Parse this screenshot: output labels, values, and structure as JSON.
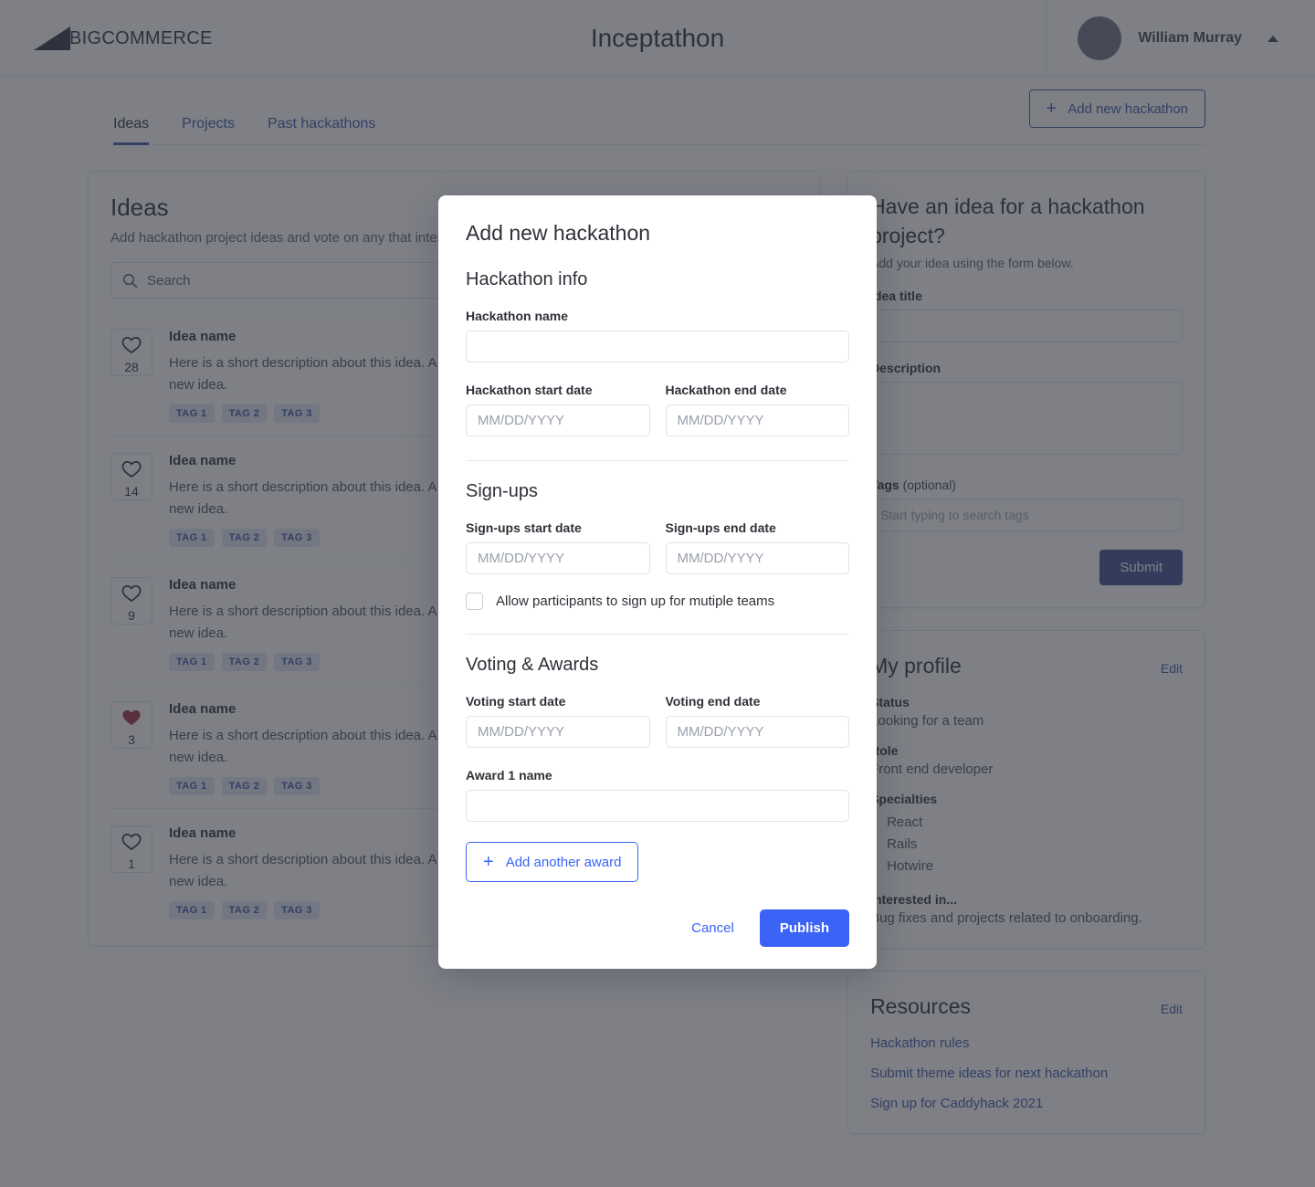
{
  "header": {
    "logo_text_bold": "BIG",
    "logo_text_rest": "COMMERCE",
    "app_title": "Inceptathon",
    "user_name": "William Murray",
    "avatar_icon": "avatar-placeholder",
    "caret_icon": "chevron-up-icon"
  },
  "nav": {
    "tabs": [
      {
        "label": "Ideas",
        "active": true
      },
      {
        "label": "Projects",
        "active": false
      },
      {
        "label": "Past hackathons",
        "active": false
      }
    ],
    "add_hackathon_label": "Add new hackathon",
    "add_icon": "plus-icon"
  },
  "ideas": {
    "title": "Ideas",
    "subtitle": "Add hackathon project ideas and vote on any that interest you.",
    "search_placeholder": "Search",
    "search_icon": "search-icon",
    "items": [
      {
        "name": "Idea name",
        "votes": "28",
        "liked": false,
        "description": "Here is a short description about this idea. A max word count in the form to add a new idea.",
        "tags": [
          "TAG 1",
          "TAG 2",
          "TAG 3"
        ]
      },
      {
        "name": "Idea name",
        "votes": "14",
        "liked": false,
        "description": "Here is a short description about this idea. A max word count in the form to add a new idea.",
        "tags": [
          "TAG 1",
          "TAG 2",
          "TAG 3"
        ]
      },
      {
        "name": "Idea name",
        "votes": "9",
        "liked": false,
        "description": "Here is a short description about this idea. A max word count in the form to add a new idea.",
        "tags": [
          "TAG 1",
          "TAG 2",
          "TAG 3"
        ]
      },
      {
        "name": "Idea name",
        "votes": "3",
        "liked": true,
        "description": "Here is a short description about this idea. A max word count in the form to add a new idea.",
        "tags": [
          "TAG 1",
          "TAG 2",
          "TAG 3"
        ]
      },
      {
        "name": "Idea name",
        "votes": "1",
        "liked": false,
        "description": "Here is a short description about this idea. A max word count in the form to add a new idea.",
        "tags": [
          "TAG 1",
          "TAG 2",
          "TAG 3"
        ]
      }
    ]
  },
  "idea_form": {
    "title": "Have an idea for a hackathon project?",
    "subtitle": "Add your idea using the form below.",
    "title_label": "Idea title",
    "title_value": "",
    "description_label": "Description",
    "description_value": "",
    "tags_label": "Tags",
    "tags_label_optional": " (optional)",
    "tags_placeholder": "Start typing to search tags",
    "submit_label": "Submit"
  },
  "profile": {
    "title": "My profile",
    "edit_label": "Edit",
    "status_label": "Status",
    "status_value": "Looking for a team",
    "role_label": "Role",
    "role_value": "Front end developer",
    "specialties_label": "Specialties",
    "specialties": [
      "React",
      "Rails",
      "Hotwire"
    ],
    "interested_label": "Interested in...",
    "interested_value": "Bug fixes and projects related to onboarding."
  },
  "resources": {
    "title": "Resources",
    "edit_label": "Edit",
    "links": [
      "Hackathon rules",
      "Submit theme ideas for next hackathon",
      "Sign up for Caddyhack 2021"
    ]
  },
  "modal": {
    "title": "Add new hackathon",
    "section_info": "Hackathon info",
    "name_label": "Hackathon name",
    "name_value": "",
    "start_label": "Hackathon start date",
    "end_label": "Hackathon end date",
    "date_placeholder": "MM/DD/YYYY",
    "section_signups": "Sign-ups",
    "signup_start_label": "Sign-ups start date",
    "signup_end_label": "Sign-ups end date",
    "multi_team_label": "Allow participants to sign up for mutiple teams",
    "multi_team_checked": false,
    "section_voting": "Voting & Awards",
    "voting_start_label": "Voting start date",
    "voting_end_label": "Voting end date",
    "award_label": "Award 1 name",
    "award_value": "",
    "add_award_label": "Add another award",
    "add_award_icon": "plus-icon",
    "cancel_label": "Cancel",
    "publish_label": "Publish"
  },
  "colors": {
    "brand_navy": "#3c55a5",
    "accent_blue": "#3b63f6",
    "submit_navy": "#3c4e93",
    "heart_red": "#9e2b3f",
    "overlay": "rgba(46,50,59,0.62)"
  }
}
